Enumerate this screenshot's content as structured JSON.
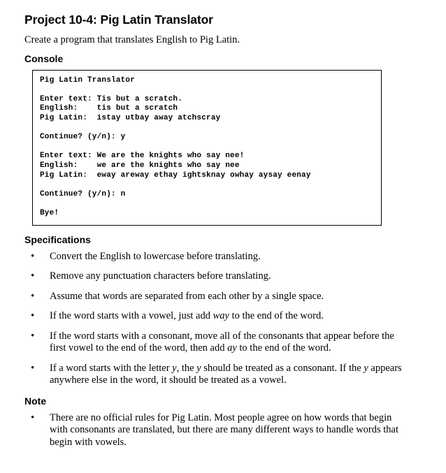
{
  "document": {
    "title": "Project 10-4: Pig Latin Translator",
    "intro": "Create a program that translates English to Pig Latin."
  },
  "console": {
    "heading": "Console",
    "transcript": "Pig Latin Translator\n\nEnter text: Tis but a scratch.\nEnglish:    tis but a scratch\nPig Latin:  istay utbay away atchscray\n\nContinue? (y/n): y\n\nEnter text: We are the knights who say nee!\nEnglish:    we are the knights who say nee\nPig Latin:  eway areway ethay ightsknay owhay aysay eenay\n\nContinue? (y/n): n\n\nBye!",
    "lines": [
      "Pig Latin Translator",
      "",
      "Enter text: Tis but a scratch.",
      "English:    tis but a scratch",
      "Pig Latin:  istay utbay away atchscray",
      "",
      "Continue? (y/n): y",
      "",
      "Enter text: We are the knights who say nee!",
      "English:    we are the knights who say nee",
      "Pig Latin:  eway areway ethay ightsknay owhay aysay eenay",
      "",
      "Continue? (y/n): n",
      "",
      "Bye!"
    ]
  },
  "specifications": {
    "heading": "Specifications",
    "items": [
      {
        "pre": "Convert the English to lowercase before translating.",
        "italic1": "",
        "mid": "",
        "italic2": "",
        "post": ""
      },
      {
        "pre": "Remove any punctuation characters before translating.",
        "italic1": "",
        "mid": "",
        "italic2": "",
        "post": ""
      },
      {
        "pre": "Assume that words are separated from each other by a single space.",
        "italic1": "",
        "mid": "",
        "italic2": "",
        "post": ""
      },
      {
        "pre": "If the word starts with a vowel, just add ",
        "italic1": "way",
        "mid": " to the end of the word.",
        "italic2": "",
        "post": ""
      },
      {
        "pre": "If the word starts with a consonant, move all of the consonants that appear before the first vowel to the end of the word, then add ",
        "italic1": "ay",
        "mid": " to the end of the word.",
        "italic2": "",
        "post": ""
      },
      {
        "pre": "If a word starts with the letter ",
        "italic1": "y",
        "mid": ", the ",
        "italic2": "y",
        "post": " should be treated as a consonant. If the "
      }
    ],
    "item6_italic3": "y",
    "item6_tail": " appears anywhere else in the word, it should be treated as a vowel."
  },
  "note": {
    "heading": "Note",
    "items": [
      "There are no official rules for Pig Latin. Most people agree on how words that begin with consonants are translated, but there are many different ways to handle words that begin with vowels."
    ]
  }
}
